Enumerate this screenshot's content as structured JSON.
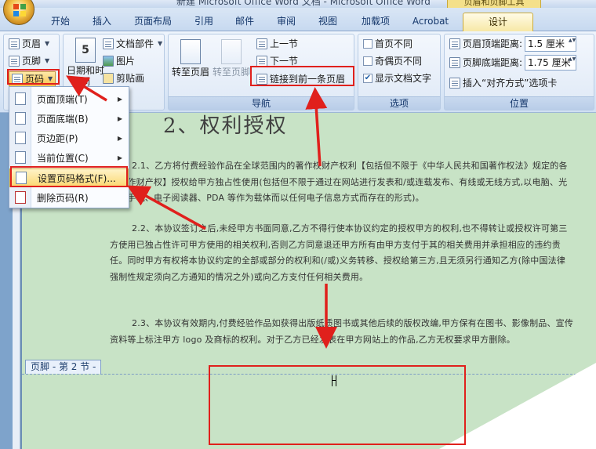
{
  "window": {
    "title": "新建 Microsoft Office Word 文档 - Microsoft Office Word",
    "context_tab_header": "页眉和页脚工具"
  },
  "tabs": [
    {
      "label": "开始"
    },
    {
      "label": "插入"
    },
    {
      "label": "页面布局"
    },
    {
      "label": "引用"
    },
    {
      "label": "邮件"
    },
    {
      "label": "审阅"
    },
    {
      "label": "视图"
    },
    {
      "label": "加载项"
    },
    {
      "label": "Acrobat"
    },
    {
      "label": "设计",
      "active": true
    }
  ],
  "ribbon": {
    "header_footer": {
      "header": "页眉",
      "footer": "页脚",
      "page_number": "页码"
    },
    "insert": {
      "date_time": "日期和时间",
      "doc_parts": "文档部件",
      "picture": "图片",
      "clip_art": "剪贴画"
    },
    "navigation": {
      "goto_header": "转至页眉",
      "goto_footer": "转至页脚",
      "previous_section": "上一节",
      "next_section": "下一节",
      "link_to_previous": "链接到前一条页眉",
      "group_label": "导航"
    },
    "options": {
      "different_first_page": "首页不同",
      "different_odd_even": "奇偶页不同",
      "show_document_text": "显示文档文字",
      "show_document_text_checked": true,
      "group_label": "选项"
    },
    "position": {
      "header_from_top_label": "页眉顶端距离:",
      "header_from_top_value": "1.5 厘米",
      "footer_from_bottom_label": "页脚底端距离:",
      "footer_from_bottom_value": "1.75 厘米",
      "insert_alignment_tab": "插入“对齐方式”选项卡",
      "group_label": "位置"
    }
  },
  "page_number_menu": {
    "items": [
      {
        "label": "页面顶端(T)",
        "submenu": true
      },
      {
        "label": "页面底端(B)",
        "submenu": true
      },
      {
        "label": "页边距(P)",
        "submenu": true
      },
      {
        "label": "当前位置(C)",
        "submenu": true
      },
      {
        "label": "设置页码格式(F)...",
        "highlighted": true
      },
      {
        "label": "删除页码(R)"
      }
    ]
  },
  "document": {
    "heading": "2、权利授权",
    "paragraphs": [
      "2.1、乙方将付费经验作品在全球范围内的著作权财产权利【包括但不限于《中华人民共和国著作权法》规定的各项著作财产权】授权给甲方独占性使用(包括但不限于通过在网站进行发表和/或连载发布、有线或无线方式,以电脑、光盘、手机、电子阅读器、PDA 等作为载体而以任何电子信息方式而存在的形式)。",
      "2.2、本协议签订之后,未经甲方书面同意,乙方不得行使本协议约定的授权甲方的权利,也不得转让或授权许可第三方使用已独占性许可甲方使用的相关权利,否则乙方同意退还甲方所有由甲方支付于其的相关费用并承担相应的违约责任。同时甲方有权将本协议约定的全部或部分的权利和(/或)义务转移、授权给第三方,且无须另行通知乙方(除中国法律强制性规定须向乙方通知的情况之外)或向乙方支付任何相关费用。",
      "2.3、本协议有效期内,付费经验作品如获得出版纸质图书或其他后续的版权改编,甲方保有在图书、影像制品、宣传资料等上标注甲方 logo 及商标的权利。对于乙方已经发表在甲方网站上的作品,乙方无权要求甲方删除。"
    ],
    "footer_label": "页脚 - 第 2 节 -"
  },
  "colors": {
    "highlight_red": "#e0201c",
    "page_background": "#c8e3c6",
    "menu_highlight": "#fbd872"
  }
}
